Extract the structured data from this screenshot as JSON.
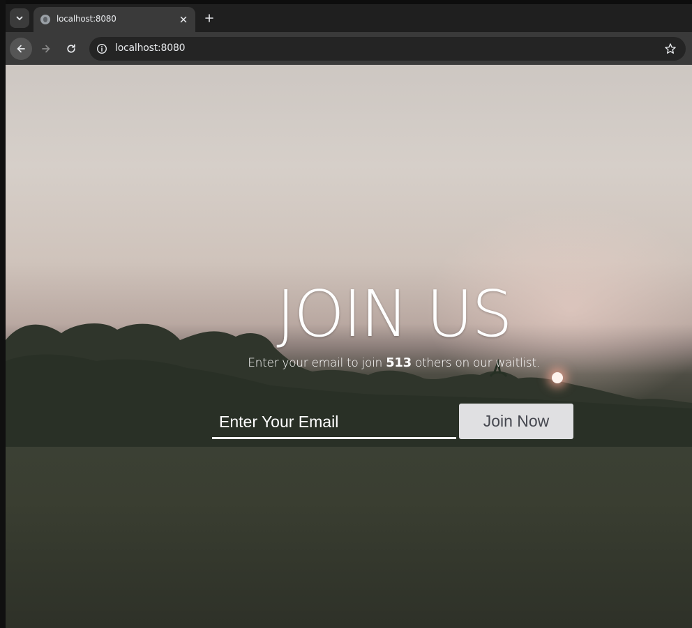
{
  "browser": {
    "tab": {
      "title": "localhost:8080",
      "favicon": "globe-icon"
    },
    "address_bar": {
      "url": "localhost:8080"
    },
    "icons": {
      "tab_menu": "chevron-down-icon",
      "close": "close-icon",
      "new_tab": "plus-icon",
      "back": "arrow-left-icon",
      "forward": "arrow-right-icon",
      "reload": "reload-icon",
      "site_info": "info-icon",
      "bookmark": "star-icon"
    }
  },
  "hero": {
    "title": "JOIN US",
    "subtitle_before": "Enter your email to join ",
    "waitlist_count": "513",
    "subtitle_after": " others on our waitlist."
  },
  "form": {
    "email_placeholder": "Enter Your Email",
    "email_value": "",
    "submit_label": "Join Now"
  },
  "colors": {
    "button_bg": "#e0e0e2",
    "button_text": "#45474f",
    "text": "#ffffff"
  }
}
